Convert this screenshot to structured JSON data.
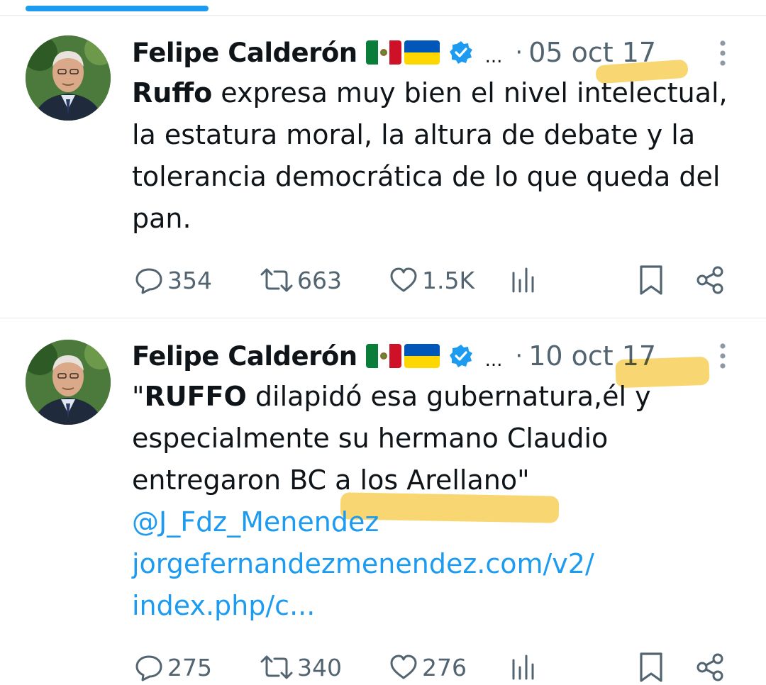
{
  "colors": {
    "accent": "#1d9bf0",
    "secondary_text": "#536471",
    "primary_text": "#0f1419",
    "highlight": "#f5c83c"
  },
  "tweets": [
    {
      "author": "Felipe Calderón",
      "ellipsis": "...",
      "separator": "·",
      "date": "05 oct 17",
      "body_bold": "Ruffo",
      "body_rest": " expresa muy bien el nivel intelectual, la estatura moral, la altura de debate y la tolerancia democrática de lo que queda del pan.",
      "replies": "354",
      "retweets": "663",
      "likes": "1.5K"
    },
    {
      "author": "Felipe Calderón",
      "ellipsis": "...",
      "separator": "·",
      "date": "10 oct 17",
      "body_open_quote": "\"",
      "body_bold": "RUFFO",
      "body_rest": " dilapidó esa gubernatura,él y especialmente su hermano Claudio entregaron BC a los Arellano\"",
      "mention": "@J_Fdz_Menendez",
      "link_line1": "jorgefernandezmenendez.com/v2/",
      "link_line2": "index.php/c...",
      "replies": "275",
      "retweets": "340",
      "likes": "276"
    }
  ],
  "icons": [
    "more-icon",
    "reply-icon",
    "retweet-icon",
    "like-icon",
    "views-icon",
    "bookmark-icon",
    "share-icon",
    "verified-icon",
    "mexico-flag-icon",
    "ukraine-flag-icon"
  ]
}
